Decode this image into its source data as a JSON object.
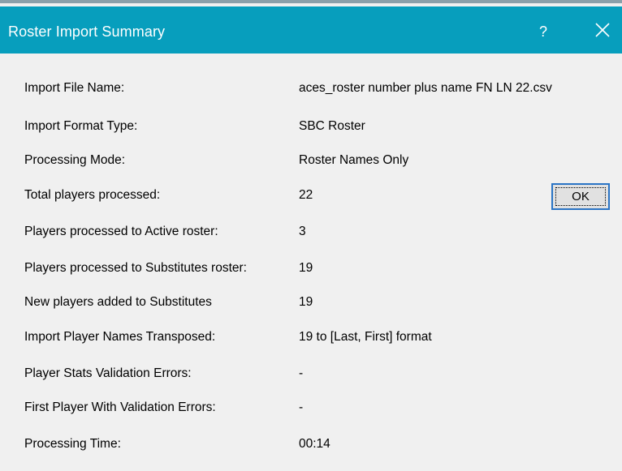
{
  "dialog": {
    "title": "Roster Import Summary",
    "help_label": "?",
    "ok_label": "OK"
  },
  "colors": {
    "titlebar": "#079ebd",
    "background": "#f0f0f0",
    "button_border": "#2a74c5"
  },
  "rows": [
    {
      "label": "Import File Name:",
      "value": "aces_roster number plus name FN LN 22.csv"
    },
    {
      "label": "Import Format Type:",
      "value": "SBC Roster"
    },
    {
      "label": "Processing Mode:",
      "value": "Roster Names Only"
    },
    {
      "label": "Total players processed:",
      "value": "22"
    },
    {
      "label": "Players processed to Active roster:",
      "value": "3"
    },
    {
      "label": "Players processed to Substitutes roster:",
      "value": "19"
    },
    {
      "label": "New players added to Substitutes",
      "value": "19"
    },
    {
      "label": "Import Player Names Transposed:",
      "value": "19 to [Last, First] format"
    },
    {
      "label": "Player Stats Validation Errors:",
      "value": "-"
    },
    {
      "label": "First Player With Validation Errors:",
      "value": "-"
    },
    {
      "label": "Processing Time:",
      "value": "00:14"
    }
  ]
}
